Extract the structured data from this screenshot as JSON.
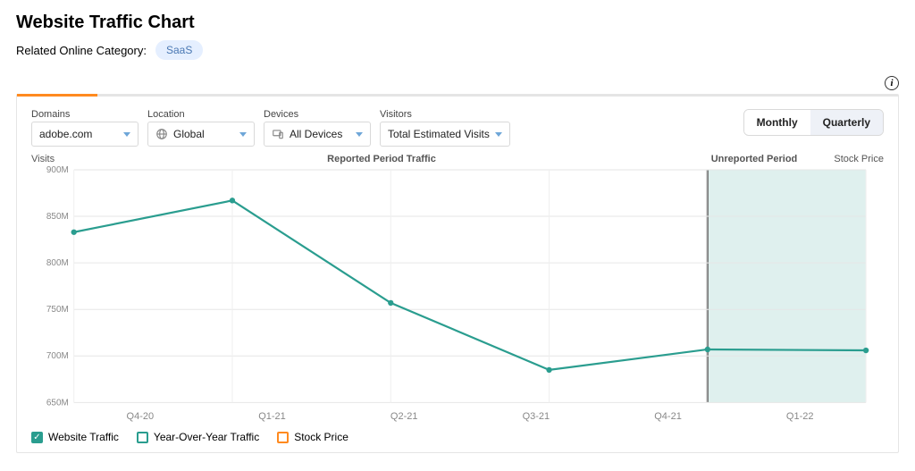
{
  "header": {
    "title": "Website Traffic Chart",
    "related_label": "Related Online Category:",
    "related_value": "SaaS"
  },
  "controls": {
    "domains": {
      "label": "Domains",
      "value": "adobe.com"
    },
    "location": {
      "label": "Location",
      "value": "Global"
    },
    "devices": {
      "label": "Devices",
      "value": "All Devices"
    },
    "visitors": {
      "label": "Visitors",
      "value": "Total Estimated Visits"
    },
    "granularity": {
      "monthly": "Monthly",
      "quarterly": "Quarterly",
      "active": "quarterly"
    }
  },
  "chart_labels": {
    "yaxis": "Visits",
    "reported": "Reported Period Traffic",
    "unreported": "Unreported Period",
    "stock": "Stock Price"
  },
  "legend": {
    "traffic": "Website Traffic",
    "yoy": "Year-Over-Year Traffic",
    "stock": "Stock Price"
  },
  "chart_data": {
    "type": "line",
    "categories": [
      "Q4-20",
      "Q1-21",
      "Q2-21",
      "Q3-21",
      "Q4-21",
      "Q1-22"
    ],
    "series": [
      {
        "name": "Website Traffic",
        "values": [
          833,
          867,
          757,
          685,
          707,
          706
        ],
        "color": "#2a9d8f"
      }
    ],
    "ylabel": "Visits",
    "yticks": [
      "900M",
      "850M",
      "800M",
      "750M",
      "700M",
      "650M"
    ],
    "ylim": [
      650,
      900
    ],
    "unreported_start_index": 4,
    "right_axis_label": "Stock Price"
  }
}
